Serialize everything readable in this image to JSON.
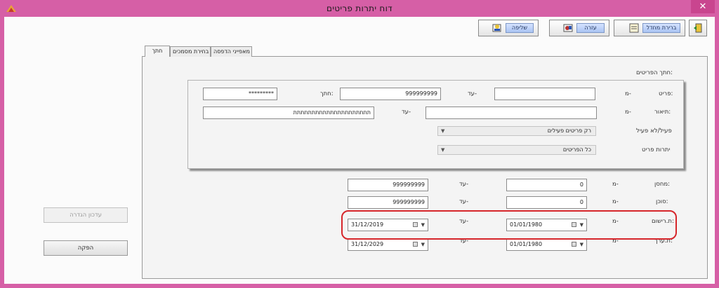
{
  "window": {
    "title": "דוח יתרות פריטים",
    "close_glyph": "✕"
  },
  "toolbar": {
    "refresh_label": "ברירת מחדל",
    "help_label": "עזרה",
    "send_label": "שליפה"
  },
  "tabs": [
    {
      "label": "חתך"
    },
    {
      "label": "בחירת מסמכים"
    },
    {
      "label": "מאפייני הדפסה"
    }
  ],
  "section_title": "חתך הפריטים:",
  "group": {
    "item_label": "פריט:",
    "item_from_label": "מ-",
    "item_from_value": "",
    "item_to_label": "עד-",
    "item_to_value": "999999999",
    "filter_label": "חתך:",
    "filter_value": "*********",
    "desc_label": "תיאור:",
    "desc_from_label": "מ-",
    "desc_from_value": "",
    "desc_to_label": "עד-",
    "desc_to_value": "תתתתתתתתתתתתתתתתתתתתת",
    "active_label": "פעיל/לא פעיל",
    "active_value": "רק פריטים פעילים",
    "balance_label": "יתרות פריט",
    "balance_value": "כל הפריטים"
  },
  "lower": {
    "warehouse_label": "מחסן:",
    "warehouse_from_label": "מ-",
    "warehouse_from_value": "0",
    "warehouse_to_label": "עד-",
    "warehouse_to_value": "999999999",
    "agent_label": "סוכן:",
    "agent_from_label": "מ-",
    "agent_from_value": "0",
    "agent_to_label": "עד-",
    "agent_to_value": "999999999",
    "date_label": "ת.רישום:",
    "date_from_label": "מ-",
    "date_from_value": "01/01/1980",
    "date_to_label": "עד-",
    "date_to_value": "31/12/2019",
    "value_label": "ת.ערך:",
    "value_from_label": "מ-",
    "value_from_value": "01/01/1980",
    "value_to_label": "עד-",
    "value_to_value": "31/12/2029"
  },
  "side": {
    "update_label": "עדכון הגדרה",
    "run_label": "הפקה"
  },
  "colors": {
    "frame": "#d65fa6",
    "highlight": "#d6262b"
  }
}
